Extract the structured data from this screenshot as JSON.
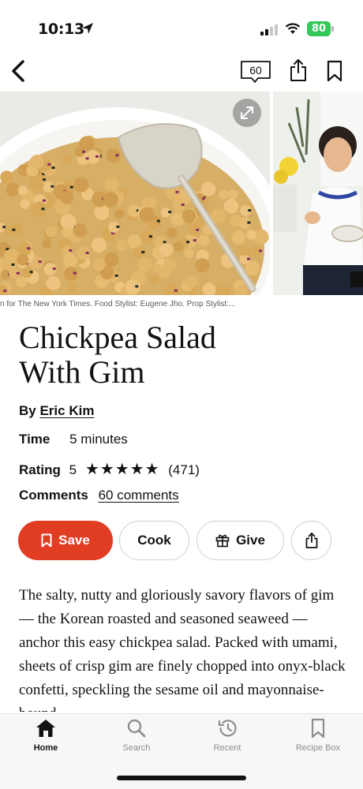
{
  "status_bar": {
    "time": "10:13",
    "battery": "80"
  },
  "nav": {
    "comment_count": "60"
  },
  "photo": {
    "caption": "n for The New York Times. Food Stylist: Eugene Jho. Prop Stylist:..."
  },
  "recipe": {
    "title_line1": "Chickpea Salad",
    "title_line2": "With Gim",
    "byline_label": "By",
    "author": "Eric Kim",
    "time_label": "Time",
    "time_value": "5 minutes",
    "rating_label": "Rating",
    "rating_value": "5",
    "rating_stars": 5,
    "rating_count": "(471)",
    "comments_label": "Comments",
    "comments_link": "60 comments",
    "description": "The salty, nutty and gloriously savory flavors of gim — the Korean roasted and seasoned seaweed — anchor this easy chickpea salad. Packed with umami, sheets of crisp gim are finely chopped into onyx-black confetti, speckling the sesame oil and mayonnaise-bound"
  },
  "actions": {
    "save": "Save",
    "cook": "Cook",
    "give": "Give"
  },
  "tabbar": {
    "home": "Home",
    "search": "Search",
    "recent": "Recent",
    "recipe_box": "Recipe Box"
  },
  "colors": {
    "save_button": "#e03d22",
    "battery": "#34c759"
  },
  "icons": [
    "location-arrow-icon",
    "signal-icon",
    "wifi-icon",
    "back-icon",
    "comment-icon",
    "share-icon",
    "bookmark-icon",
    "expand-icon",
    "gift-icon",
    "home-icon",
    "search-icon",
    "recent-icon",
    "recipe-box-icon"
  ]
}
